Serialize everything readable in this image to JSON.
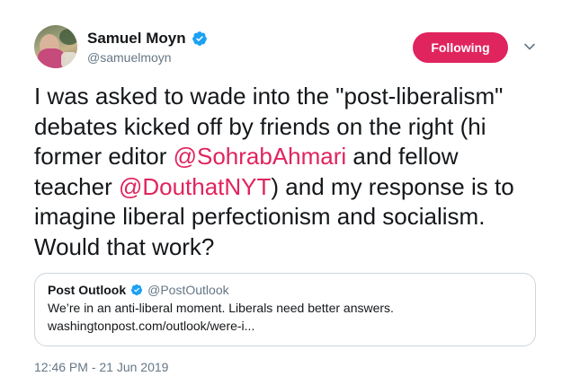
{
  "tweet": {
    "author": {
      "display_name": "Samuel Moyn",
      "handle": "@samuelmoyn",
      "verified": true
    },
    "follow_button_label": "Following",
    "text_parts": [
      {
        "text": "I was asked to wade into the \"post-liberalism\" debates kicked off by friends on the right (hi former editor ",
        "type": "text"
      },
      {
        "text": "@SohrabAhmari",
        "type": "mention"
      },
      {
        "text": " and fellow teacher ",
        "type": "text"
      },
      {
        "text": "@DouthatNYT",
        "type": "mention"
      },
      {
        "text": ") and my response is to imagine liberal perfectionism and socialism. Would that work?",
        "type": "text"
      }
    ],
    "quoted": {
      "display_name": "Post Outlook",
      "handle": "@PostOutlook",
      "verified": true,
      "text": "We’re in an anti-liberal moment. Liberals need better answers.",
      "link": "washingtonpost.com/outlook/were-i..."
    },
    "timestamp": "12:46 PM - 21 Jun 2019"
  },
  "colors": {
    "accent": "#e0245e",
    "verified_blue": "#1da1f2",
    "secondary_text": "#657786",
    "border": "#ccd6dd"
  },
  "icons": {
    "verified": "verified-badge-icon",
    "menu": "chevron-down-icon"
  }
}
